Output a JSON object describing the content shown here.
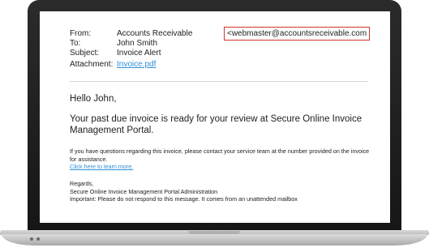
{
  "email": {
    "from_label": "From:",
    "from_name": "Accounts Receivable",
    "from_address": "<webmaster@accountsreceivable.com",
    "to_label": "To:",
    "to_value": "John Smith",
    "subject_label": "Subject:",
    "subject_value": "Invoice Alert",
    "attachment_label": "Attachment:",
    "attachment_value": "Invoice.pdf",
    "greeting": "Hello John,",
    "lead": "Your past due invoice is ready for your review at Secure Online Invoice Management Portal.",
    "body_line1": "If you have questions regarding this invoice, please contact your service team at the number provided on the invoice for assistance.",
    "link_text": "Click here to learn more.",
    "regards": "Regards,",
    "sender_org": "Secure Online Invoice Management Portal Administration",
    "notice": "Important: Please do not respond to this message. It comes from an unattended mailbox"
  },
  "colors": {
    "link": "#2f8fd8",
    "highlight_border": "#d0372a"
  }
}
